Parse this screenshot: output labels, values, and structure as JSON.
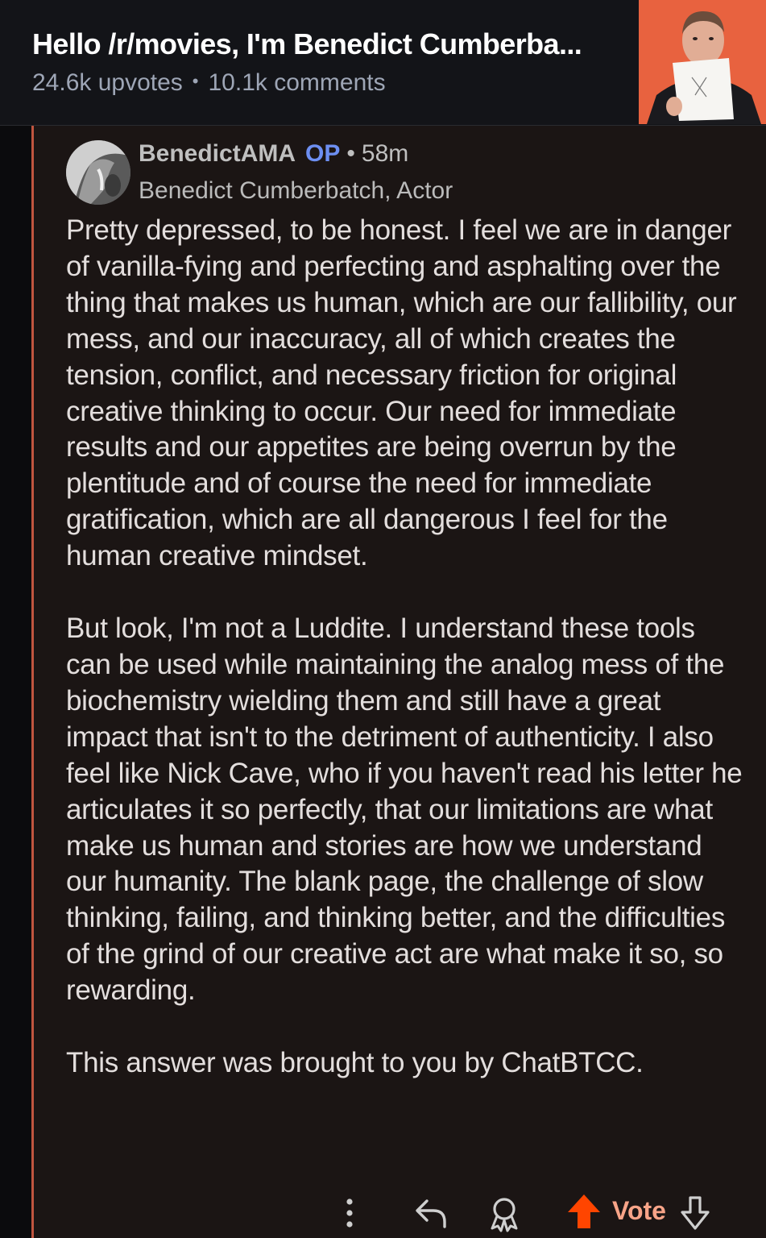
{
  "post": {
    "title": "Hello /r/movies, I'm Benedict Cumberba...",
    "upvotes": "24.6k upvotes",
    "separator": "•",
    "comments": "10.1k comments"
  },
  "thumbnail": {
    "icon": "post-thumbnail-photo"
  },
  "comment": {
    "author": "BenedictAMA",
    "op_badge": "OP",
    "separator": "•",
    "age": "58m",
    "flair": "Benedict Cumberbatch, Actor",
    "paragraphs": [
      "Pretty depressed, to be honest. I feel we are in danger of vanilla-fying and perfecting and asphalting over the thing that makes us human, which are our fallibility, our mess, and our inaccuracy, all of which creates the tension, conflict, and necessary friction for original creative thinking to occur. Our need for immediate results and our appetites are being overrun by the plentitude and of course the need for immediate gratification, which are all dangerous I feel for the human creative mindset.",
      "But look, I'm not a Luddite. I understand these tools can be used while maintaining the analog mess of the biochemistry wielding them and still have a great impact that isn't to the detriment of authenticity. I also feel like Nick Cave, who if you haven't read his letter he articulates it so perfectly, that our limitations are what make us human and stories are how we understand our humanity. The blank page, the challenge of slow thinking, failing, and thinking better, and the difficulties of the grind of our creative act are what make it so, so rewarding.",
      "This answer was brought to you by ChatBTCC."
    ]
  },
  "actions": {
    "more_icon": "more-vertical-icon",
    "reply_icon": "reply-icon",
    "award_icon": "award-icon",
    "upvote_icon": "upvote-arrow-icon",
    "vote_label": "Vote",
    "downvote_icon": "downvote-arrow-icon"
  },
  "colors": {
    "header_bg": "#131418",
    "comment_bg": "#1b1514",
    "thread_line": "#c0553f",
    "op_badge": "#6d8ff2",
    "upvote": "#ff4500",
    "vote_label": "#f8a488",
    "thumbnail_bg": "#e8623f"
  }
}
